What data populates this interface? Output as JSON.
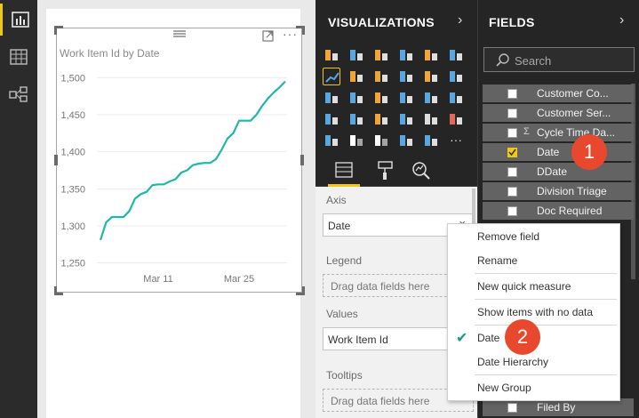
{
  "rail": {
    "items": [
      "report-view-icon",
      "data-view-icon",
      "relationships-view-icon"
    ],
    "accent": "#f2c811"
  },
  "visual": {
    "title": "Work Item Id by Date",
    "line_color": "#1fb8a6",
    "chart_data": {
      "type": "line",
      "title": "Work Item Id by Date",
      "xlabel": "",
      "ylabel": "",
      "x_tick_labels": [
        "Mar 11",
        "Mar 25"
      ],
      "y_ticks": [
        1250,
        1300,
        1350,
        1400,
        1450,
        1500
      ],
      "y_tick_labels": [
        "1,250",
        "1,300",
        "1,350",
        "1,400",
        "1,450",
        "1,500"
      ],
      "ylim": [
        1240,
        1510
      ],
      "x_range_days": [
        1,
        33
      ],
      "series": [
        {
          "x": [
            1,
            2,
            3,
            4,
            5,
            6,
            7,
            8,
            9,
            10,
            11,
            12,
            13,
            14,
            15,
            16,
            17,
            18,
            19,
            20,
            21,
            22,
            23,
            24,
            25,
            26,
            27,
            28,
            29,
            30,
            31,
            32,
            33
          ],
          "values": [
            1281,
            1305,
            1312,
            1312,
            1312,
            1320,
            1337,
            1343,
            1346,
            1355,
            1356,
            1356,
            1360,
            1363,
            1372,
            1375,
            1382,
            1384,
            1385,
            1385,
            1390,
            1403,
            1418,
            1425,
            1442,
            1442,
            1442,
            1450,
            1462,
            1472,
            1480,
            1487,
            1495
          ]
        }
      ]
    }
  },
  "viz_pane": {
    "header": "VISUALIZATIONS",
    "wells": [
      {
        "label": "Axis",
        "field": "Date"
      },
      {
        "label": "Legend",
        "placeholder": "Drag data fields here"
      },
      {
        "label": "Values",
        "field": "Work Item Id"
      },
      {
        "label": "Tooltips",
        "placeholder": "Drag data fields here"
      }
    ]
  },
  "fields_pane": {
    "header": "FIELDS",
    "search_placeholder": "Search",
    "fields": [
      {
        "name": "Customer Co...",
        "checked": false
      },
      {
        "name": "Customer Ser...",
        "checked": false
      },
      {
        "name": "Cycle Time Da...",
        "checked": false,
        "sigma": true
      },
      {
        "name": "Date",
        "checked": true
      },
      {
        "name": "DDate",
        "checked": false
      },
      {
        "name": "Division Triage",
        "checked": false
      },
      {
        "name": "Doc Required",
        "checked": false
      },
      {
        "name": "Filed By",
        "checked": false
      }
    ]
  },
  "context_menu": {
    "items": [
      "Remove field",
      "Rename",
      "New quick measure",
      "Show items with no data",
      "Date",
      "Date Hierarchy",
      "New Group"
    ],
    "checked_item": "Date"
  },
  "badges": [
    "1",
    "2"
  ]
}
